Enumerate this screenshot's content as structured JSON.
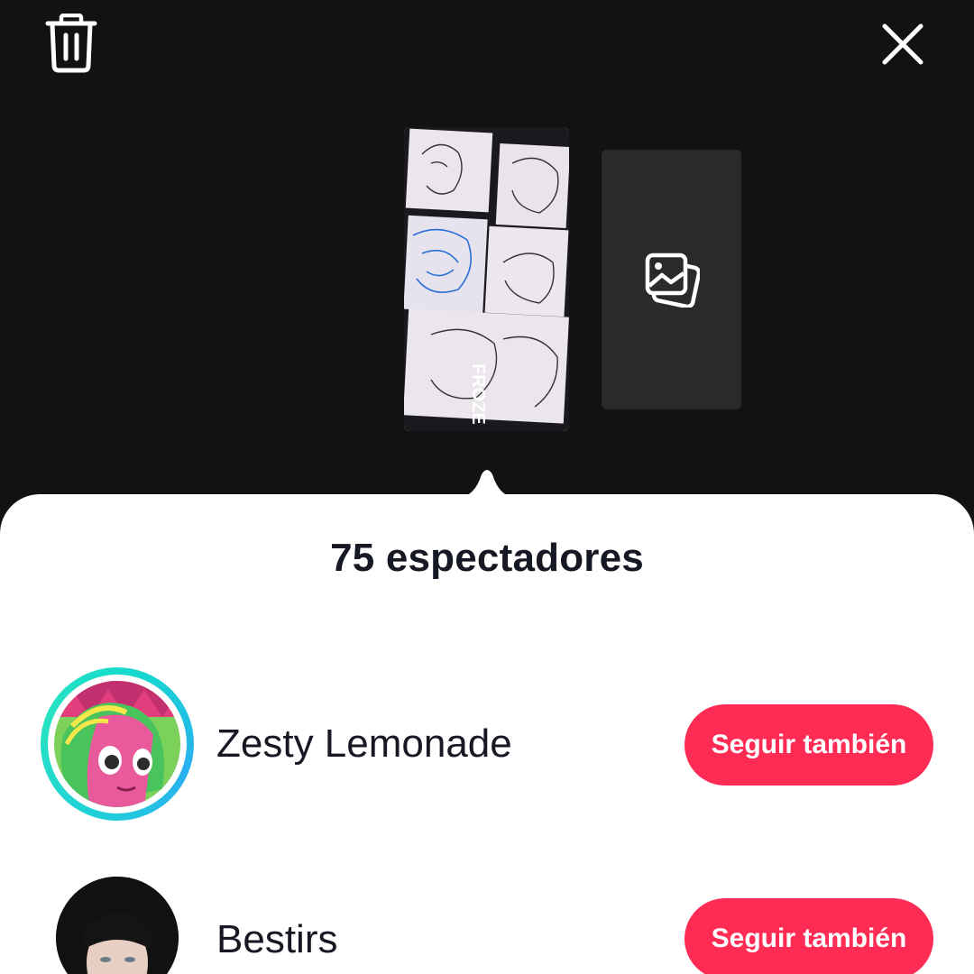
{
  "topbar": {
    "delete_icon": "trash-icon",
    "close_icon": "close-icon"
  },
  "story": {
    "next_thumb_icon": "image-stack-icon",
    "thumb_overlay_text": "THE WORLD FROZE"
  },
  "sheet": {
    "title": "75 espectadores"
  },
  "viewers": [
    {
      "name": "Zesty Lemonade",
      "button_label": "Seguir también",
      "has_story_ring": true
    },
    {
      "name": "Bestirs",
      "button_label": "Seguir también",
      "has_story_ring": false
    }
  ],
  "colors": {
    "accent": "#fe2c55",
    "ring": "#1fd1d8",
    "background": "#121212",
    "sheet": "#ffffff"
  }
}
